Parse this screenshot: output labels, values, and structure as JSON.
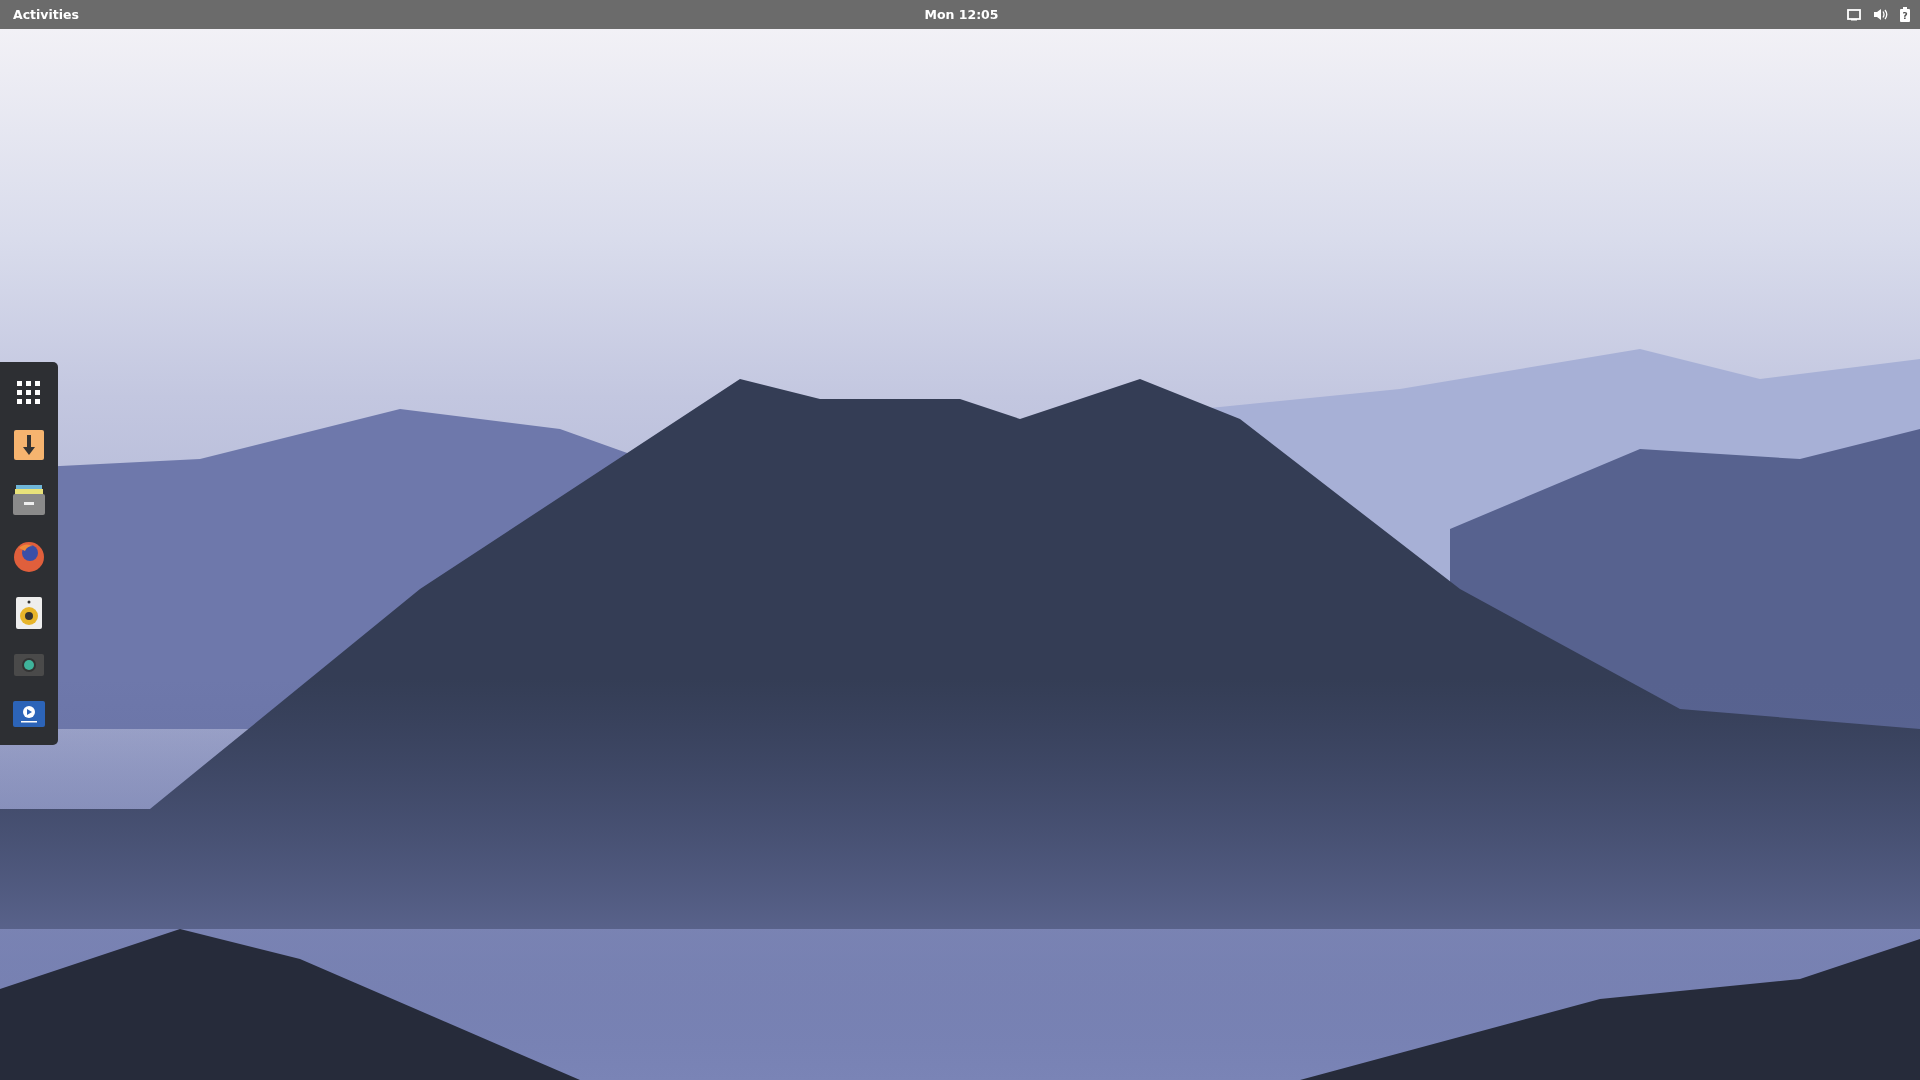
{
  "top_bar": {
    "activities": "Activities",
    "clock": "Mon 12:05",
    "battery_mark": "?"
  },
  "dock": {
    "items": [
      {
        "kind": "apps"
      },
      {
        "kind": "download"
      },
      {
        "kind": "files"
      },
      {
        "kind": "browser"
      },
      {
        "kind": "music"
      },
      {
        "kind": "camera"
      },
      {
        "kind": "video"
      }
    ]
  }
}
